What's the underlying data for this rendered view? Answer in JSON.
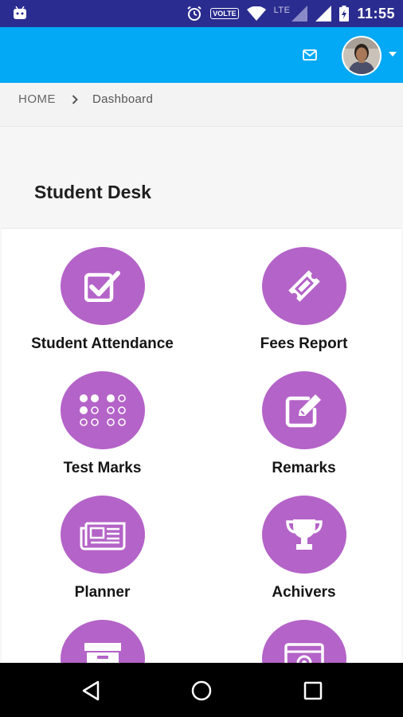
{
  "status_bar": {
    "time": "11:55",
    "volte": "VOLTE",
    "network": "LTE",
    "icons": [
      "android-icon",
      "alarm-icon",
      "wifi-icon",
      "signal-icon",
      "battery-icon"
    ]
  },
  "header": {
    "background_color": "#03a9f4",
    "icons": [
      "mail-icon",
      "avatar",
      "caret-down-icon"
    ]
  },
  "breadcrumb": {
    "home": "HOME",
    "separator_icon": "chevron-right-icon",
    "current": "Dashboard"
  },
  "page_title": "Student Desk",
  "accent_color": "#b463c8",
  "tiles": [
    {
      "label": "Student Attendance",
      "icon": "checkbox-icon"
    },
    {
      "label": "Fees Report",
      "icon": "ticket-icon"
    },
    {
      "label": "Test Marks",
      "icon": "braille-icon"
    },
    {
      "label": "Remarks",
      "icon": "edit-icon"
    },
    {
      "label": "Planner",
      "icon": "newspaper-icon"
    },
    {
      "label": "Achivers",
      "icon": "trophy-icon"
    },
    {
      "label": "",
      "icon": "archive-icon"
    },
    {
      "label": "",
      "icon": "camera-icon"
    }
  ],
  "nav_bar": {
    "icons": [
      "back-icon",
      "home-icon",
      "recents-icon"
    ]
  }
}
